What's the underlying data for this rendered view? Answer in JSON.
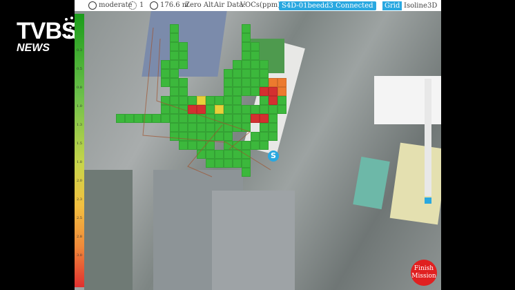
{
  "logo": {
    "line1": "TVBS",
    "line2": "NEWS"
  },
  "topbar": {
    "gps_status": "moderate",
    "satellites": "1",
    "altitude": "176.6 m",
    "altitude_mode": "Zero Alt.",
    "air_data_label": "Air Data:",
    "air_data_value": "VOCs(ppm)",
    "connection": "S4D-01beedd3 Connected",
    "modes": [
      "Grid",
      "Isoline",
      "3D"
    ],
    "active_mode": "Grid"
  },
  "legend": {
    "labels": [
      "0.3",
      "0.5",
      "0.8",
      "1.0",
      "1.3",
      "1.5",
      "1.8",
      "2.0",
      "2.3",
      "2.5",
      "2.8",
      "3.0"
    ]
  },
  "marker": {
    "label": "S"
  },
  "finish_button": {
    "label": "Finish Mission"
  },
  "colors": {
    "accent": "#29a8e0",
    "danger": "#e02020",
    "low": "#1a9c1a",
    "high": "#e03030"
  }
}
